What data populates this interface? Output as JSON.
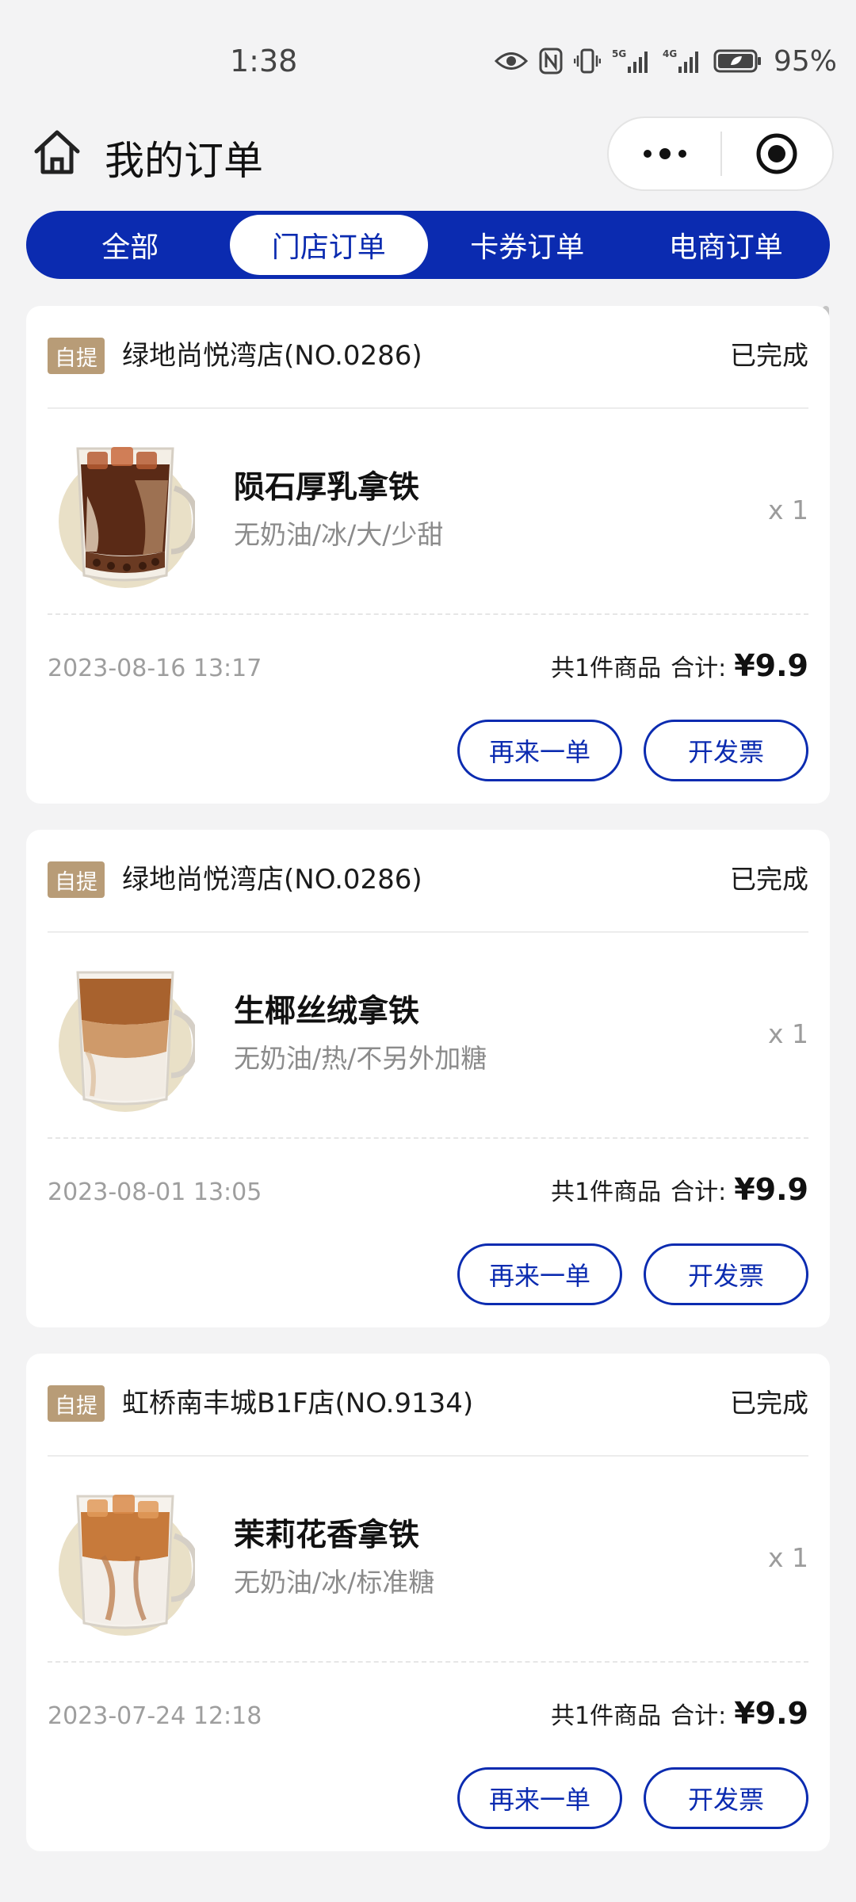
{
  "status_bar": {
    "time": "1:38",
    "icons": [
      "eye-icon",
      "nfc-icon",
      "vibrate-icon",
      "signal-5g-icon",
      "signal-4g-icon",
      "battery-icon"
    ],
    "battery": "95%"
  },
  "header": {
    "title": "我的订单",
    "home_icon": "home-icon",
    "more_icon": "more-dots-icon",
    "close_icon": "record-target-icon"
  },
  "tabs": [
    {
      "label": "全部",
      "active": false
    },
    {
      "label": "门店订单",
      "active": true
    },
    {
      "label": "卡券订单",
      "active": false
    },
    {
      "label": "电商订单",
      "active": false
    }
  ],
  "orders": [
    {
      "badge": "自提",
      "store": "绿地尚悦湾店(NO.0286)",
      "status": "已完成",
      "item_name": "陨石厚乳拿铁",
      "item_spec": "无奶油/冰/大/少甜",
      "qty": "x 1",
      "time": "2023-08-16 13:17",
      "count_text": "共1件商品",
      "total_label": "合计:",
      "total": "¥9.9",
      "reorder_label": "再来一单",
      "invoice_label": "开发票"
    },
    {
      "badge": "自提",
      "store": "绿地尚悦湾店(NO.0286)",
      "status": "已完成",
      "item_name": "生椰丝绒拿铁",
      "item_spec": "无奶油/热/不另外加糖",
      "qty": "x 1",
      "time": "2023-08-01 13:05",
      "count_text": "共1件商品",
      "total_label": "合计:",
      "total": "¥9.9",
      "reorder_label": "再来一单",
      "invoice_label": "开发票"
    },
    {
      "badge": "自提",
      "store": "虹桥南丰城B1F店(NO.9134)",
      "status": "已完成",
      "item_name": "茉莉花香拿铁",
      "item_spec": "无奶油/冰/标准糖",
      "qty": "x 1",
      "time": "2023-07-24 12:18",
      "count_text": "共1件商品",
      "total_label": "合计:",
      "total": "¥9.9",
      "reorder_label": "再来一单",
      "invoice_label": "开发票"
    }
  ],
  "colors": {
    "brand_blue": "#0b2bb0",
    "badge_tan": "#b89c77",
    "page_bg": "#f3f3f4"
  }
}
